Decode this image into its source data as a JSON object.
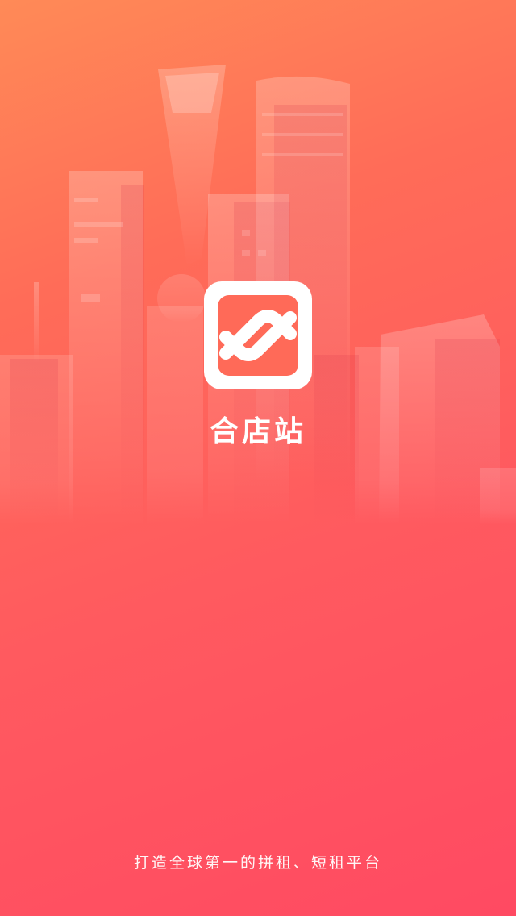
{
  "app": {
    "name": "合店站",
    "slogan": "打造全球第一的拼租、短租平台"
  },
  "logo": {
    "icon": "app-logo-icon"
  },
  "background": {
    "illustration": "city-skyline",
    "gradient_colors": [
      "#ff8a57",
      "#ff6c58",
      "#ff5a5f",
      "#ff4a62"
    ]
  }
}
